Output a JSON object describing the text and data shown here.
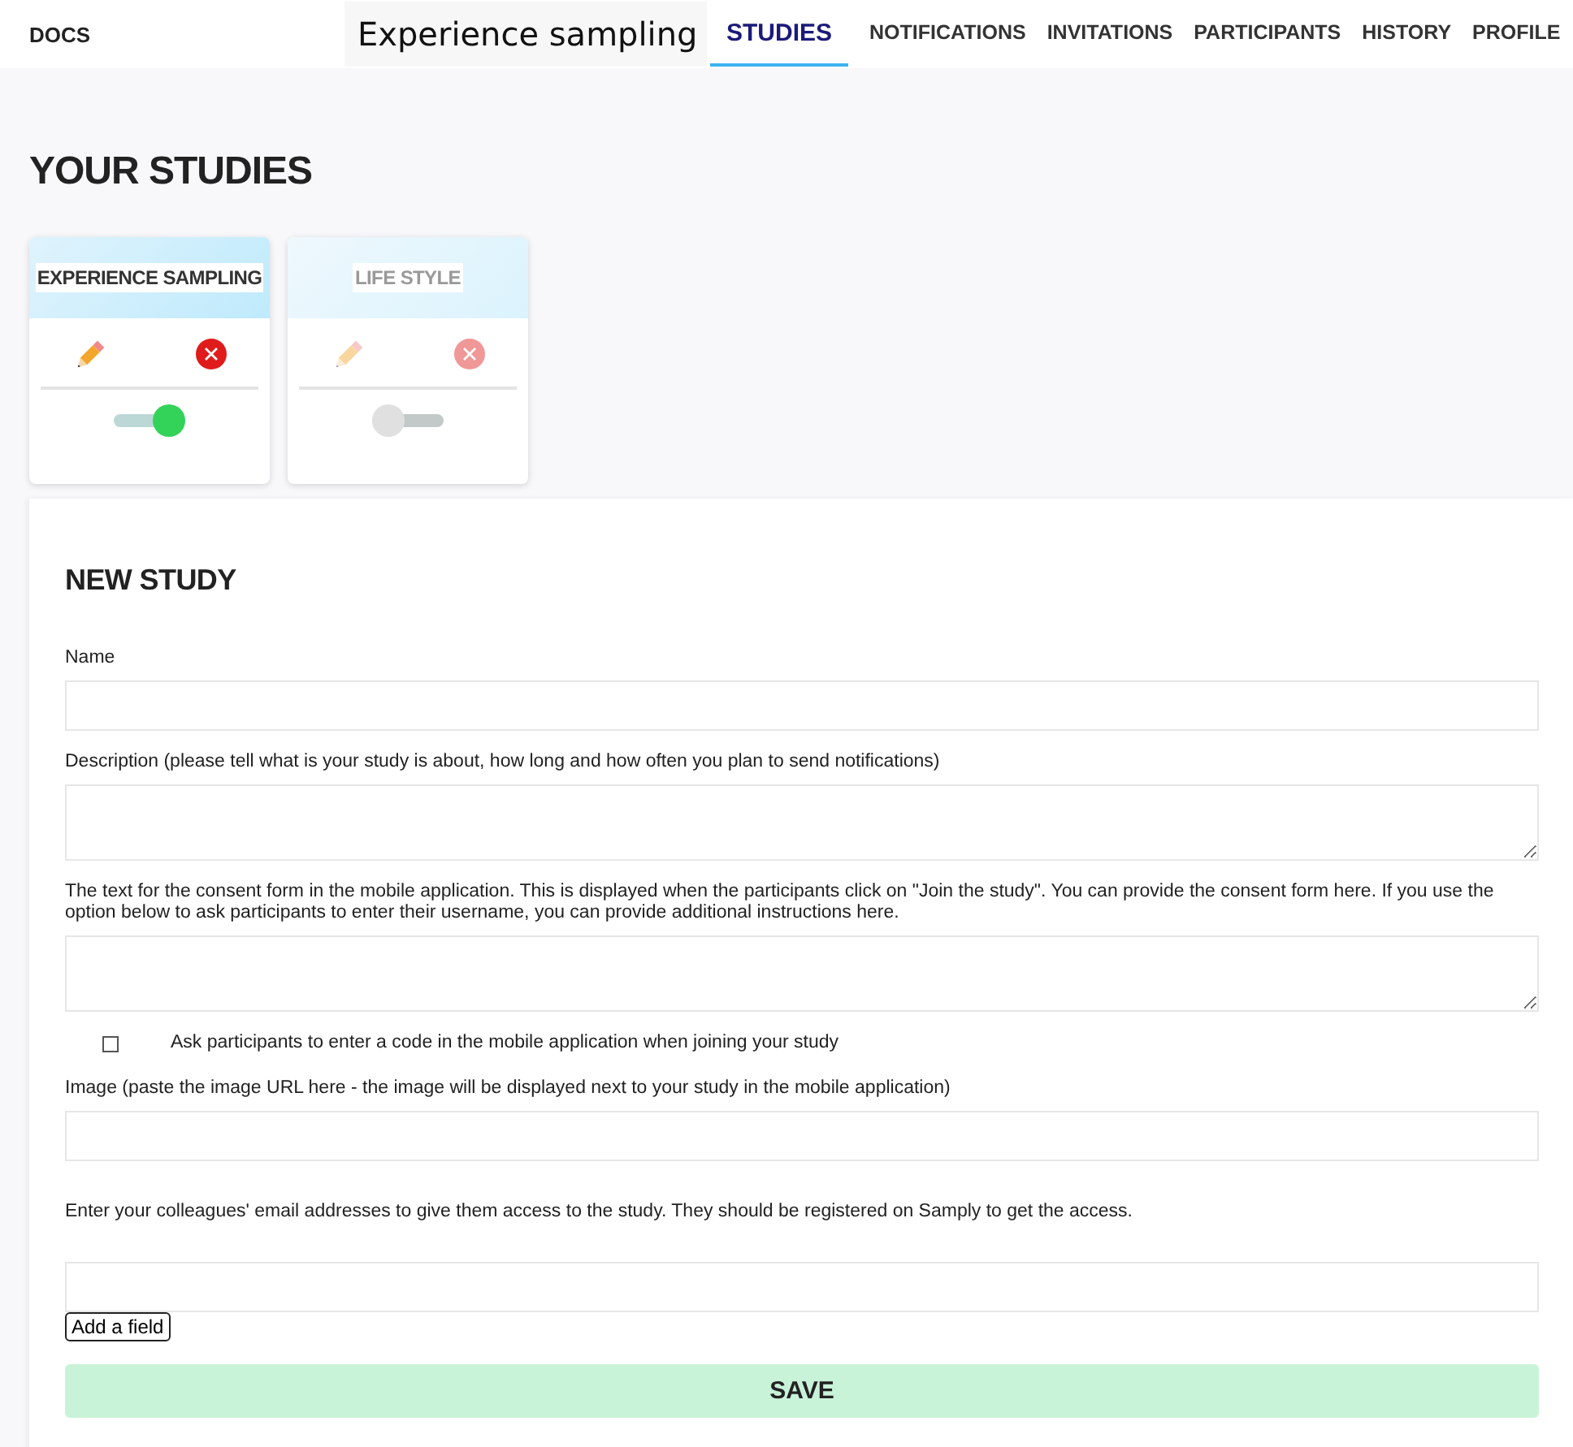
{
  "nav": {
    "docs": "DOCS",
    "study_select": "Experience sampling",
    "tabs": [
      {
        "label": "STUDIES",
        "selected": true
      },
      {
        "label": "NOTIFICATIONS",
        "selected": false
      },
      {
        "label": "INVITATIONS",
        "selected": false
      },
      {
        "label": "PARTICIPANTS",
        "selected": false
      },
      {
        "label": "HISTORY",
        "selected": false
      },
      {
        "label": "PROFILE",
        "selected": false
      }
    ]
  },
  "heading": "YOUR STUDIES",
  "studies": [
    {
      "title": "EXPERIENCE SAMPLING",
      "active": true
    },
    {
      "title": "LIFE STYLE",
      "active": false
    }
  ],
  "form": {
    "title": "NEW STUDY",
    "fields": [
      {
        "kind": "input",
        "label": "Name"
      },
      {
        "kind": "textarea",
        "label": "Description (please tell what is your study is about, how long and how often you plan to send notifications)"
      },
      {
        "kind": "textarea",
        "label": "The text for the consent form in the mobile application. This is displayed when the participants click on \"Join the study\". You can provide the consent form here. If you use the option below to ask participants to enter their username, you can provide additional instructions here."
      },
      {
        "kind": "checkbox",
        "label": "Ask participants to enter a code in the mobile application when joining your study",
        "checked": false
      },
      {
        "kind": "input",
        "label": "Image (paste the image URL here - the image will be displayed next to your study in the mobile application)"
      },
      {
        "kind": "input",
        "label": "Enter your colleagues' email addresses to give them access to the study. They should be registered on Samply to get the access."
      }
    ],
    "add_button": "Add a field",
    "save_button": "SAVE"
  }
}
